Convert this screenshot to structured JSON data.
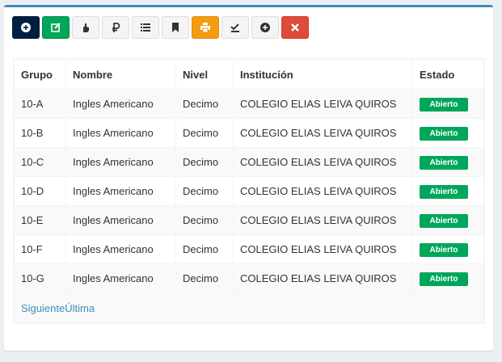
{
  "toolbar": {
    "buttons": [
      {
        "icon": "plus-circle-icon",
        "variant": "navy"
      },
      {
        "icon": "edit-icon",
        "variant": "green"
      },
      {
        "icon": "hand-icon",
        "variant": "default"
      },
      {
        "icon": "ruble-icon",
        "variant": "default"
      },
      {
        "icon": "list-icon",
        "variant": "default"
      },
      {
        "icon": "bookmark-icon",
        "variant": "default"
      },
      {
        "icon": "print-icon",
        "variant": "orange"
      },
      {
        "icon": "check-icon",
        "variant": "default"
      },
      {
        "icon": "plus-circle-icon",
        "variant": "default"
      },
      {
        "icon": "close-icon",
        "variant": "red"
      }
    ]
  },
  "table": {
    "headers": {
      "grupo": "Grupo",
      "nombre": "Nombre",
      "nivel": "Nivel",
      "institucion": "Institución",
      "estado": "Estado"
    },
    "rows": [
      {
        "grupo": "10-A",
        "nombre": "Ingles Americano",
        "nivel": "Decimo",
        "institucion": "COLEGIO ELIAS LEIVA QUIROS",
        "estado": "Abierto"
      },
      {
        "grupo": "10-B",
        "nombre": "Ingles Americano",
        "nivel": "Decimo",
        "institucion": "COLEGIO ELIAS LEIVA QUIROS",
        "estado": "Abierto"
      },
      {
        "grupo": "10-C",
        "nombre": "Ingles Americano",
        "nivel": "Decimo",
        "institucion": "COLEGIO ELIAS LEIVA QUIROS",
        "estado": "Abierto"
      },
      {
        "grupo": "10-D",
        "nombre": "Ingles Americano",
        "nivel": "Decimo",
        "institucion": "COLEGIO ELIAS LEIVA QUIROS",
        "estado": "Abierto"
      },
      {
        "grupo": "10-E",
        "nombre": "Ingles Americano",
        "nivel": "Decimo",
        "institucion": "COLEGIO ELIAS LEIVA QUIROS",
        "estado": "Abierto"
      },
      {
        "grupo": "10-F",
        "nombre": "Ingles Americano",
        "nivel": "Decimo",
        "institucion": "COLEGIO ELIAS LEIVA QUIROS",
        "estado": "Abierto"
      },
      {
        "grupo": "10-G",
        "nombre": "Ingles Americano",
        "nivel": "Decimo",
        "institucion": "COLEGIO ELIAS LEIVA QUIROS",
        "estado": "Abierto"
      }
    ]
  },
  "pagination": {
    "next": "Siguiente",
    "last": "Última"
  },
  "colors": {
    "accent": "#3c8dbc",
    "success": "#00a65a",
    "navy": "#001f3f",
    "warning": "#f39c12",
    "danger": "#dd4b39"
  }
}
